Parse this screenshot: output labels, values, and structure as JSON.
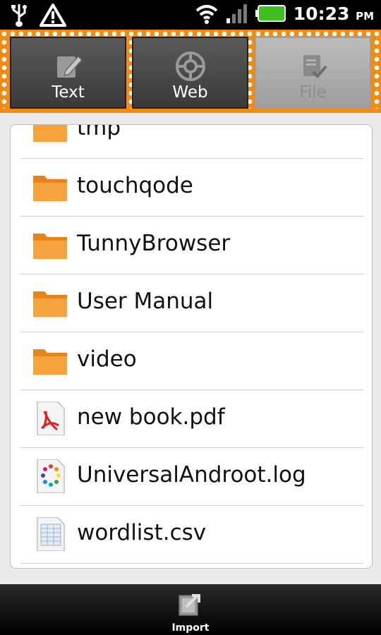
{
  "status": {
    "time": "10:23",
    "ampm": "PM"
  },
  "tabs": [
    {
      "label": "Text",
      "icon": "edit-icon",
      "active": false
    },
    {
      "label": "Web",
      "icon": "globe-icon",
      "active": false
    },
    {
      "label": "File",
      "icon": "file-check-icon",
      "active": true
    }
  ],
  "files": [
    {
      "name": "tmp",
      "type": "folder"
    },
    {
      "name": "touchqode",
      "type": "folder"
    },
    {
      "name": "TunnyBrowser",
      "type": "folder"
    },
    {
      "name": "User Manual",
      "type": "folder"
    },
    {
      "name": "video",
      "type": "folder"
    },
    {
      "name": "new book.pdf",
      "type": "pdf"
    },
    {
      "name": "UniversalAndroot.log",
      "type": "log"
    },
    {
      "name": "wordlist.csv",
      "type": "csv"
    }
  ],
  "bottom": {
    "import_label": "Import",
    "icon": "import-icon"
  },
  "colors": {
    "accent": "#f08c14",
    "folder": "#f09a2a"
  }
}
